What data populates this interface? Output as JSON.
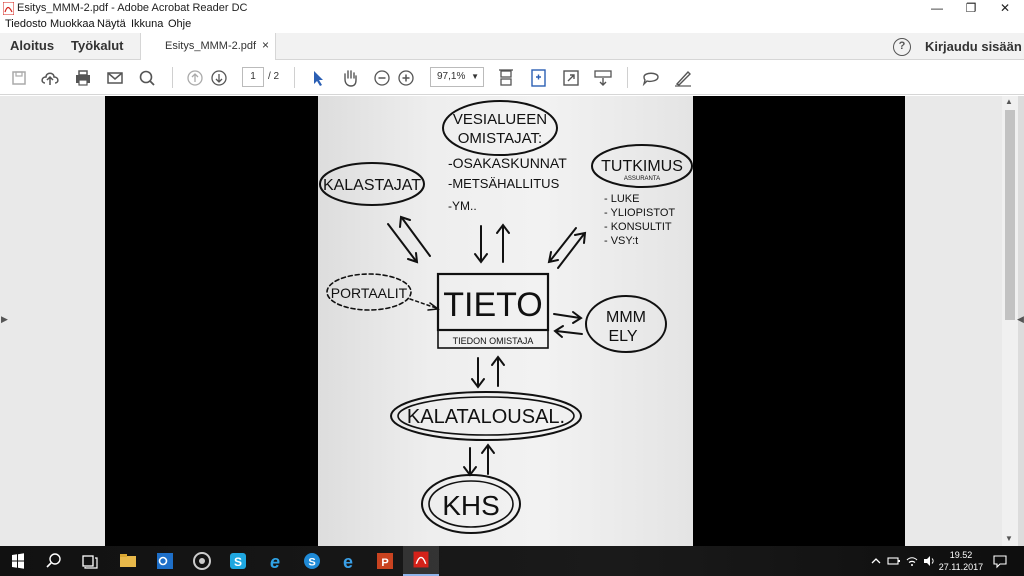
{
  "window": {
    "title": "Esitys_MMM-2.pdf - Adobe Acrobat Reader DC",
    "minimize_symbol": "—",
    "restore_symbol": "❐",
    "close_symbol": "✕"
  },
  "menubar": {
    "items": [
      "Tiedosto",
      "Muokkaa",
      "Näytä",
      "Ikkuna",
      "Ohje"
    ]
  },
  "tabbar": {
    "home": "Aloitus",
    "tools": "Työkalut",
    "doc_tab": "Esitys_MMM-2.pdf",
    "close_tab": "×",
    "help": "?",
    "signin": "Kirjaudu sisään"
  },
  "toolbar": {
    "page_current": "1",
    "page_total": "/ 2",
    "zoom": "97,1%"
  },
  "document": {
    "diagram": {
      "water_owners_title_1": "VESIALUEEN",
      "water_owners_title_2": "OMISTAJAT:",
      "water_owners_items": [
        "-OSAKASKUNNAT",
        "-METSÄHALLITUS",
        "-YM.."
      ],
      "fishers": "KALASTAJAT",
      "research_title": "TUTKIMUS",
      "research_subtitle": "ASSURANTA",
      "research_items": [
        "- LUKE",
        "- YLIOPISTOT",
        "- KONSULTIT",
        "- VSY:t"
      ],
      "portals": "PORTAALIT",
      "center": "TIETO",
      "center_sub": "TIEDON OMISTAJA",
      "mmm_1": "MMM",
      "mmm_2": "ELY",
      "fishery": "KALATALOUSAL.",
      "khs": "KHS"
    }
  },
  "taskbar": {
    "time": "19.52",
    "date": "27.11.2017"
  },
  "colors": {
    "accent": "#2b5fb4",
    "acrobat_red": "#d4221a",
    "taskbar": "#111111"
  }
}
